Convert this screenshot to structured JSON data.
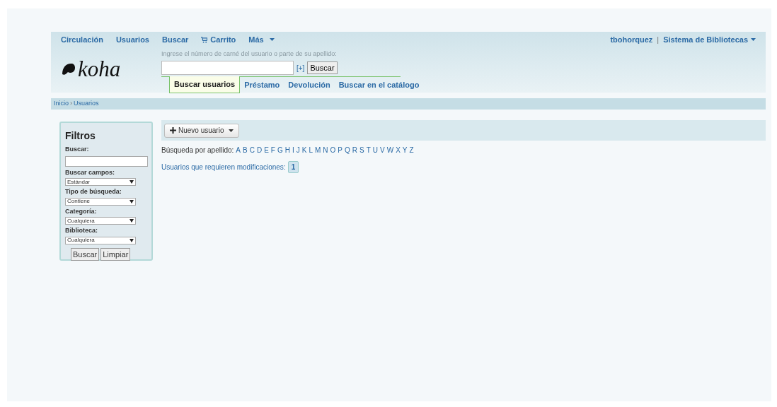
{
  "top_nav": [
    {
      "label": "Circulación",
      "kind": "link"
    },
    {
      "label": "Usuarios",
      "kind": "link"
    },
    {
      "label": "Buscar",
      "kind": "link"
    },
    {
      "label": "Carrito",
      "kind": "cart"
    },
    {
      "label": "Más",
      "kind": "menu"
    }
  ],
  "user_menu": {
    "user": "tbohorquez",
    "separator": "|",
    "library": "Sistema de Bibliotecas"
  },
  "logo": "koha",
  "search": {
    "label": "Ingrese el número de carné del usuario o parte de su apellido:",
    "more": "[+]",
    "button": "Buscar"
  },
  "search_tabs": [
    {
      "label": "Buscar usuarios",
      "selected": true
    },
    {
      "label": "Préstamo",
      "selected": false
    },
    {
      "label": "Devolución",
      "selected": false
    },
    {
      "label": "Buscar en el catálogo",
      "selected": false
    }
  ],
  "breadcrumb": {
    "home": "Inicio",
    "separator": "›",
    "current": "Usuarios"
  },
  "filters": {
    "title": "Filtros",
    "search_label": "Buscar:",
    "selects": [
      {
        "label": "Buscar campos:",
        "value": "Estándar"
      },
      {
        "label": "Tipo de búsqueda:",
        "value": "Contiene"
      },
      {
        "label": "Categoría:",
        "value": "Cualquiera"
      },
      {
        "label": "Biblioteca:",
        "value": "Cualquiera"
      }
    ],
    "buttons": [
      "Buscar",
      "Limpiar"
    ]
  },
  "toolbar": {
    "new_button": "Nuevo usuario"
  },
  "alphabet": {
    "label": "Búsqueda por apellido:",
    "letters": [
      "A",
      "B",
      "C",
      "D",
      "E",
      "F",
      "G",
      "H",
      "I",
      "J",
      "K",
      "L",
      "M",
      "N",
      "O",
      "P",
      "Q",
      "R",
      "S",
      "T",
      "U",
      "V",
      "W",
      "X",
      "Y",
      "Z"
    ]
  },
  "modifications": {
    "label": "Usuarios que requieren modificaciones:",
    "count": "1"
  }
}
